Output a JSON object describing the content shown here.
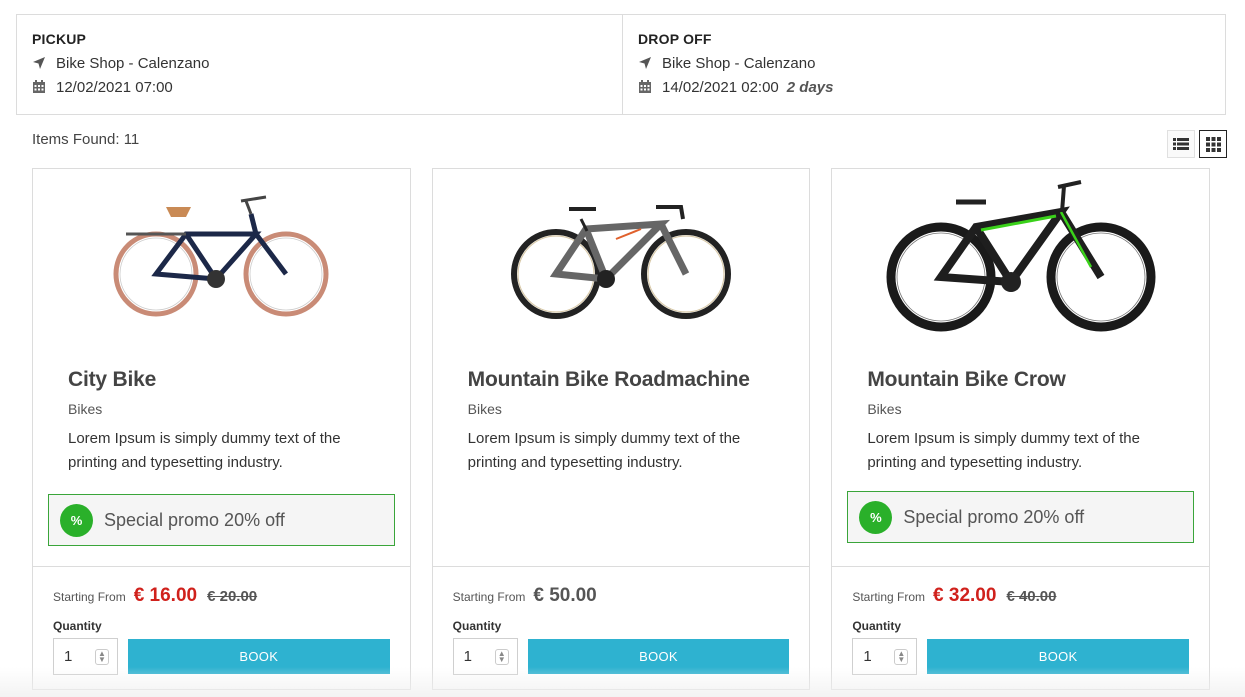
{
  "summary": {
    "pickup": {
      "title": "PICKUP",
      "location": "Bike Shop - Calenzano",
      "datetime": "12/02/2021 07:00"
    },
    "dropoff": {
      "title": "DROP OFF",
      "location": "Bike Shop - Calenzano",
      "datetime": "14/02/2021 02:00",
      "duration": "2 days"
    }
  },
  "results": {
    "items_found": "Items Found: 11"
  },
  "view_toggle": {
    "list_icon": "list-view-icon",
    "grid_icon": "grid-view-icon",
    "active": "grid"
  },
  "labels": {
    "starting_from": "Starting From",
    "quantity": "Quantity",
    "book": "BOOK"
  },
  "colors": {
    "accent": "#2eb2d0",
    "promo": "#2ab02a",
    "price_red": "#d0211c"
  },
  "products": [
    {
      "name": "City Bike",
      "category": "Bikes",
      "description": "Lorem Ipsum is simply dummy text of the printing and typesetting industry.",
      "promo": "Special promo 20% off",
      "price": "€ 16.00",
      "old_price": "€ 20.00",
      "quantity": "1"
    },
    {
      "name": "Mountain Bike Roadmachine",
      "category": "Bikes",
      "description": "Lorem Ipsum is simply dummy text of the printing and typesetting industry.",
      "promo": "",
      "price": "€ 50.00",
      "old_price": "",
      "quantity": "1"
    },
    {
      "name": "Mountain Bike Crow",
      "category": "Bikes",
      "description": "Lorem Ipsum is simply dummy text of the printing and typesetting industry.",
      "promo": "Special promo 20% off",
      "price": "€ 32.00",
      "old_price": "€ 40.00",
      "quantity": "1"
    }
  ]
}
